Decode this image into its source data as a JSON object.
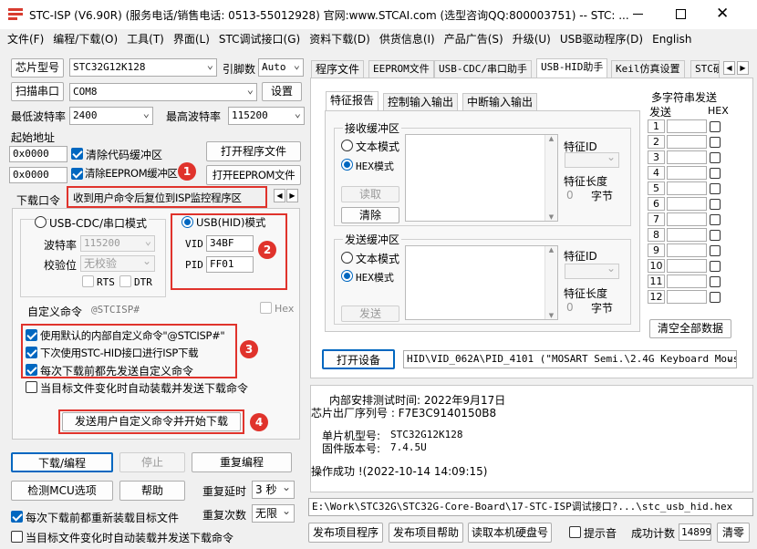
{
  "window": {
    "title": "STC-ISP (V6.90R) (服务电话/销售电话: 0513-55012928) 官网:www.STCAI.com  (选型咨询QQ:800003751) -- STC: ...",
    "controls": [
      "minimize-icon",
      "maximize-icon",
      "close-icon"
    ]
  },
  "menu": [
    "文件(F)",
    "编程/下载(O)",
    "工具(T)",
    "界面(L)",
    "STC调试接口(G)",
    "资料下载(D)",
    "供货信息(I)",
    "产品广告(S)",
    "升级(U)",
    "USB驱动程序(D)",
    "English"
  ],
  "left": {
    "chip_btn": "芯片型号",
    "chip_value": "STC32G12K128",
    "pins_label": "引脚数",
    "pins_value": "Auto",
    "scan_btn": "扫描串口",
    "port_value": "COM8",
    "settings_btn": "设置",
    "min_baud_label": "最低波特率",
    "min_baud_value": "2400",
    "max_baud_label": "最高波特率",
    "max_baud_value": "115200",
    "start_addr_label": "起始地址",
    "addr1": "0x0000",
    "clear_code_label": "清除代码缓冲区",
    "open_prog_btn": "打开程序文件",
    "addr2": "0x0000",
    "clear_eeprom_label": "清除EEPROM缓冲区",
    "open_eeprom_btn": "打开EEPROM文件",
    "tabs": [
      "下载口令",
      "收到用户命令后复位到ISP监控程序区"
    ],
    "cdc_mode_label": "USB-CDC/串口模式",
    "baud_label": "波特率",
    "baud_value": "115200",
    "parity_label": "校验位",
    "parity_value": "无校验",
    "rts_label": "RTS",
    "dtr_label": "DTR",
    "hid_mode_label": "USB(HID)模式",
    "vid_label": "VID",
    "vid_value": "34BF",
    "pid_label": "PID",
    "pid_value": "FF01",
    "custom_cmd_label": "自定义命令",
    "custom_cmd_value": "@STCISP#",
    "hex_label": "Hex",
    "opt1": "使用默认的内部自定义命令\"@STCISP#\"",
    "opt2": "下次使用STC-HID接口进行ISP下载",
    "opt3": "每次下载前都先发送自定义命令",
    "opt4": "当目标文件变化时自动装载并发送下载命令",
    "send_cmd_btn": "发送用户自定义命令并开始下载",
    "badges": [
      "1",
      "2",
      "3",
      "4"
    ],
    "download_btn": "下载/编程",
    "stop_btn": "停止",
    "reprogram_btn": "重复编程",
    "check_mcu_btn": "检测MCU选项",
    "help_btn": "帮助",
    "repeat_delay_label": "重复延时",
    "repeat_delay_value": "3 秒",
    "repeat_count_label": "重复次数",
    "repeat_count_value": "无限",
    "reload_label": "每次下载前都重新装载目标文件",
    "auto_reload_label": "当目标文件变化时自动装载并发送下载命令"
  },
  "right": {
    "tabs": [
      "程序文件",
      "EEPROM文件",
      "USB-CDC/串口助手",
      "USB-HID助手",
      "Keil仿真设置",
      "STC硬"
    ],
    "sub_tabs": [
      "特征报告",
      "控制输入输出",
      "中断输入输出"
    ],
    "recv_group": "接收缓冲区",
    "text_mode": "文本模式",
    "hex_mode": "HEX模式",
    "read_btn": "读取",
    "clear_btn": "清除",
    "feature_id_label": "特征ID",
    "feature_len_label": "特征长度",
    "feature_len_value": "0",
    "bytes_label": "字节",
    "send_group": "发送缓冲区",
    "send_btn": "发送",
    "multi_title": "多字符串发送",
    "send_col": "发送",
    "hex_col": "HEX",
    "multi_rows": [
      "1",
      "2",
      "3",
      "4",
      "5",
      "6",
      "7",
      "8",
      "9",
      "10",
      "11",
      "12"
    ],
    "clear_all_btn": "清空全部数据",
    "open_device_btn": "打开设备",
    "device_value": "HID\\VID_062A\\PID_4101 (\"MOSART Semi.\\2.4G Keyboard Mous:",
    "log": {
      "l1": "内部安排测试时间: 2022年9月17日",
      "l2": "芯片出厂序列号 : F7E3C9140150B8",
      "l3_label": "单片机型号:",
      "l3_value": "STC32G12K128",
      "l4_label": "固件版本号:",
      "l4_value": "7.4.5U",
      "l5": "操作成功 !(2022-10-14 14:09:15)"
    },
    "path": "E:\\Work\\STC32G\\STC32G-Core-Board\\17-STC-ISP调试接口?...\\stc_usb_hid.hex",
    "publish_btn": "发布项目程序",
    "publish_help_btn": "发布项目帮助",
    "read_disk_btn": "读取本机硬盘号",
    "beep_label": "提示音",
    "success_label": "成功计数",
    "success_value": "14899",
    "clear_count_btn": "清零"
  },
  "colors": {
    "accent": "#0067c0",
    "highlight": "#e0332c"
  }
}
